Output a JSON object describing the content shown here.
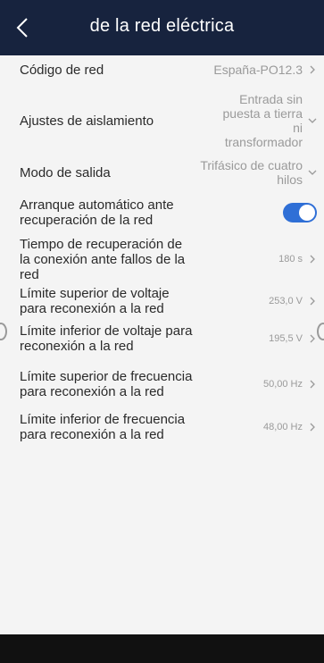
{
  "header": {
    "title": "de la red eléctrica"
  },
  "settings": [
    {
      "label": "Código de red",
      "value": "España-PO12.3",
      "chevron": "right"
    },
    {
      "label": "Ajustes de aislamiento",
      "value": "Entrada sin puesta a tierra ni transformador",
      "chevron": "down"
    },
    {
      "label": "Modo de salida",
      "value": "Trifásico de cuatro hilos",
      "chevron": "down"
    },
    {
      "label": "Arranque automático ante recuperación de la red",
      "toggle_on": true
    },
    {
      "label": "Tiempo de recuperación de la conexión ante fallos de la red",
      "value": "180 s",
      "chevron": "right"
    },
    {
      "label": "Límite superior de voltaje para reconexión a la red",
      "value": "253,0 V",
      "chevron": "right"
    },
    {
      "label": "Límite inferior de voltaje para reconexión a la red",
      "value": "195,5 V",
      "chevron": "right"
    },
    {
      "label": "Límite superior de frecuencia para reconexión a la red",
      "value": "50,00 Hz",
      "chevron": "right"
    },
    {
      "label": "Límite inferior de frecuencia para reconexión a la red",
      "value": "48,00 Hz",
      "chevron": "right"
    }
  ],
  "colors": {
    "header_bg": "#17233e",
    "toggle_on": "#2f6fd6"
  }
}
